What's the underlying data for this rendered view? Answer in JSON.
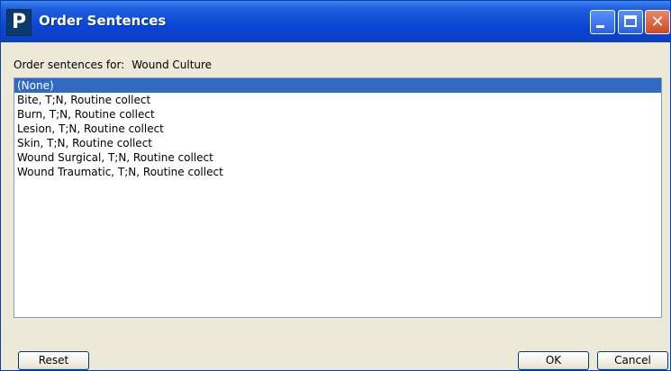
{
  "window": {
    "title": "Order Sentences",
    "app_icon_letter": "P"
  },
  "content": {
    "order_label": "Order sentences for:",
    "order_item": "Wound Culture",
    "list_items": [
      "(None)",
      "Bite, T;N, Routine collect",
      "Burn, T;N, Routine collect",
      "Lesion, T;N, Routine collect",
      "Skin, T;N, Routine collect",
      "Wound Surgical, T;N, Routine collect",
      "Wound Traumatic, T;N, Routine collect"
    ],
    "selected_index": 0
  },
  "buttons": {
    "reset": "Reset",
    "ok": "OK",
    "cancel": "Cancel"
  },
  "icons": {
    "app": "app-logo-icon",
    "minimize": "minimize-icon",
    "maximize": "maximize-icon",
    "close": "close-icon"
  },
  "colors": {
    "titlebar": "#0a46d4",
    "selection": "#316ac5",
    "dialog_bg": "#ece9d8",
    "close_button": "#cf4a22"
  }
}
